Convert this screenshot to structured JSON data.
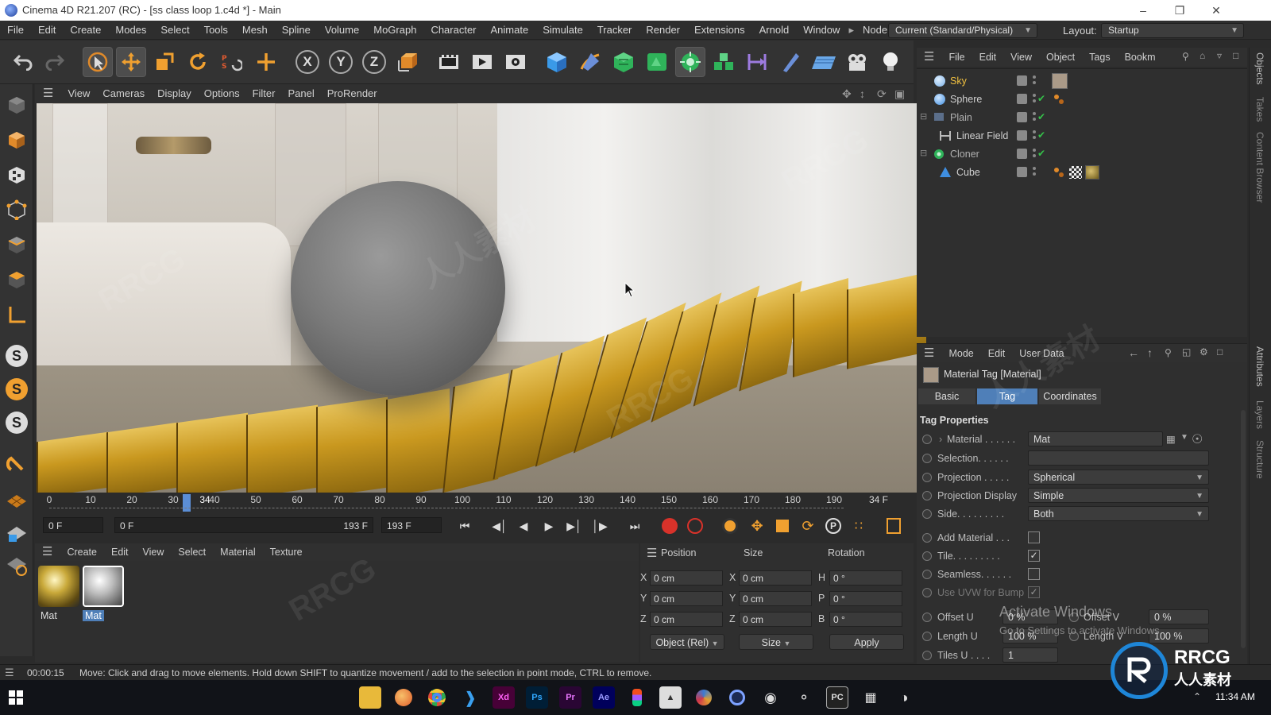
{
  "window": {
    "title": "Cinema 4D R21.207 (RC) - [ss class loop 1.c4d *] - Main"
  },
  "menubar": {
    "items": [
      "File",
      "Edit",
      "Create",
      "Modes",
      "Select",
      "Tools",
      "Mesh",
      "Spline",
      "Volume",
      "MoGraph",
      "Character",
      "Animate",
      "Simulate",
      "Tracker",
      "Render",
      "Extensions",
      "Arnold",
      "Window"
    ],
    "node_space_label": "Node Space:",
    "node_space_value": "Current (Standard/Physical)",
    "layout_label": "Layout:",
    "layout_value": "Startup"
  },
  "toolbar": {
    "x_label": "X",
    "y_label": "Y",
    "z_label": "Z"
  },
  "viewport_menu": {
    "items": [
      "View",
      "Cameras",
      "Display",
      "Options",
      "Filter",
      "Panel",
      "ProRender"
    ]
  },
  "object_manager": {
    "menu": [
      "File",
      "Edit",
      "View",
      "Object",
      "Tags",
      "Bookm"
    ],
    "objects": [
      {
        "name": "Sky",
        "color": "#f0c040"
      },
      {
        "name": "Sphere",
        "color": "#d0d0d0"
      },
      {
        "name": "Plain",
        "color": "#b0b0b0"
      },
      {
        "name": "Linear Field",
        "color": "#d0d0d0"
      },
      {
        "name": "Cloner",
        "color": "#b0b0b0"
      },
      {
        "name": "Cube",
        "color": "#d0d0d0"
      }
    ]
  },
  "attribute_manager": {
    "menu": [
      "Mode",
      "Edit",
      "User Data"
    ],
    "object_title": "Material Tag [Material]",
    "tabs": [
      "Basic",
      "Tag",
      "Coordinates"
    ],
    "active_tab": "Tag",
    "section": "Tag Properties",
    "props": {
      "material_label": "Material . . . . . .",
      "material_value": "Mat",
      "selection_label": "Selection. . . . . .",
      "projection_label": "Projection . . . . .",
      "projection_value": "Spherical",
      "projection_display_label": "Projection Display",
      "projection_display_value": "Simple",
      "side_label": "Side. . . . . . . . .",
      "side_value": "Both",
      "add_material_label": "Add Material . . .",
      "tile_label": "Tile. . . . . . . . .",
      "seamless_label": "Seamless. . . . . .",
      "use_uvw_label": "Use UVW for Bump",
      "offset_u_label": "Offset U",
      "offset_u_value": "0 %",
      "offset_v_label": "Offset V",
      "offset_v_value": "0 %",
      "length_u_label": "Length U",
      "length_u_value": "100 %",
      "length_v_label": "Length V",
      "length_v_value": "100 %",
      "tiles_u_label": "Tiles U . . . .",
      "tiles_u_value": "1"
    }
  },
  "timeline": {
    "ticks": [
      "0",
      "10",
      "20",
      "30",
      "40",
      "50",
      "60",
      "70",
      "80",
      "90",
      "100",
      "110",
      "120",
      "130",
      "140",
      "150",
      "160",
      "170",
      "180",
      "190"
    ],
    "current_frame_marker": "34",
    "end_label": "34 F"
  },
  "transport": {
    "start_frame": "0 F",
    "current_frame": "0 F",
    "end_frame": "193 F",
    "end_frame2": "193 F"
  },
  "material_manager": {
    "menu": [
      "Create",
      "Edit",
      "View",
      "Select",
      "Material",
      "Texture"
    ],
    "materials": [
      "Mat",
      "Mat"
    ]
  },
  "coordinates": {
    "headers": [
      "Position",
      "Size",
      "Rotation"
    ],
    "pos": {
      "x": "0 cm",
      "y": "0 cm",
      "z": "0 cm"
    },
    "size": {
      "x": "0 cm",
      "y": "0 cm",
      "z": "0 cm"
    },
    "rot": {
      "h": "0 °",
      "p": "0 °",
      "b": "0 °"
    },
    "mode": "Object (Rel)",
    "size_mode": "Size",
    "apply": "Apply"
  },
  "statusbar": {
    "time": "00:00:15",
    "message": "Move: Click and drag to move elements. Hold down SHIFT to quantize movement / add to the selection in point mode, CTRL to remove."
  },
  "side_tabs": [
    "Objects",
    "Takes",
    "Content Browser",
    "Attributes",
    "Layers",
    "Structure"
  ],
  "activate_windows": {
    "line1": "Activate Windows",
    "line2": "Go to Settings to activate Windows."
  },
  "taskbar": {
    "clock": "11:34 AM",
    "apps": [
      "Xd",
      "Ps",
      "Pr",
      "Ae",
      "PC"
    ]
  },
  "watermark": {
    "brand": "RRCG",
    "cn": "人人素材"
  }
}
